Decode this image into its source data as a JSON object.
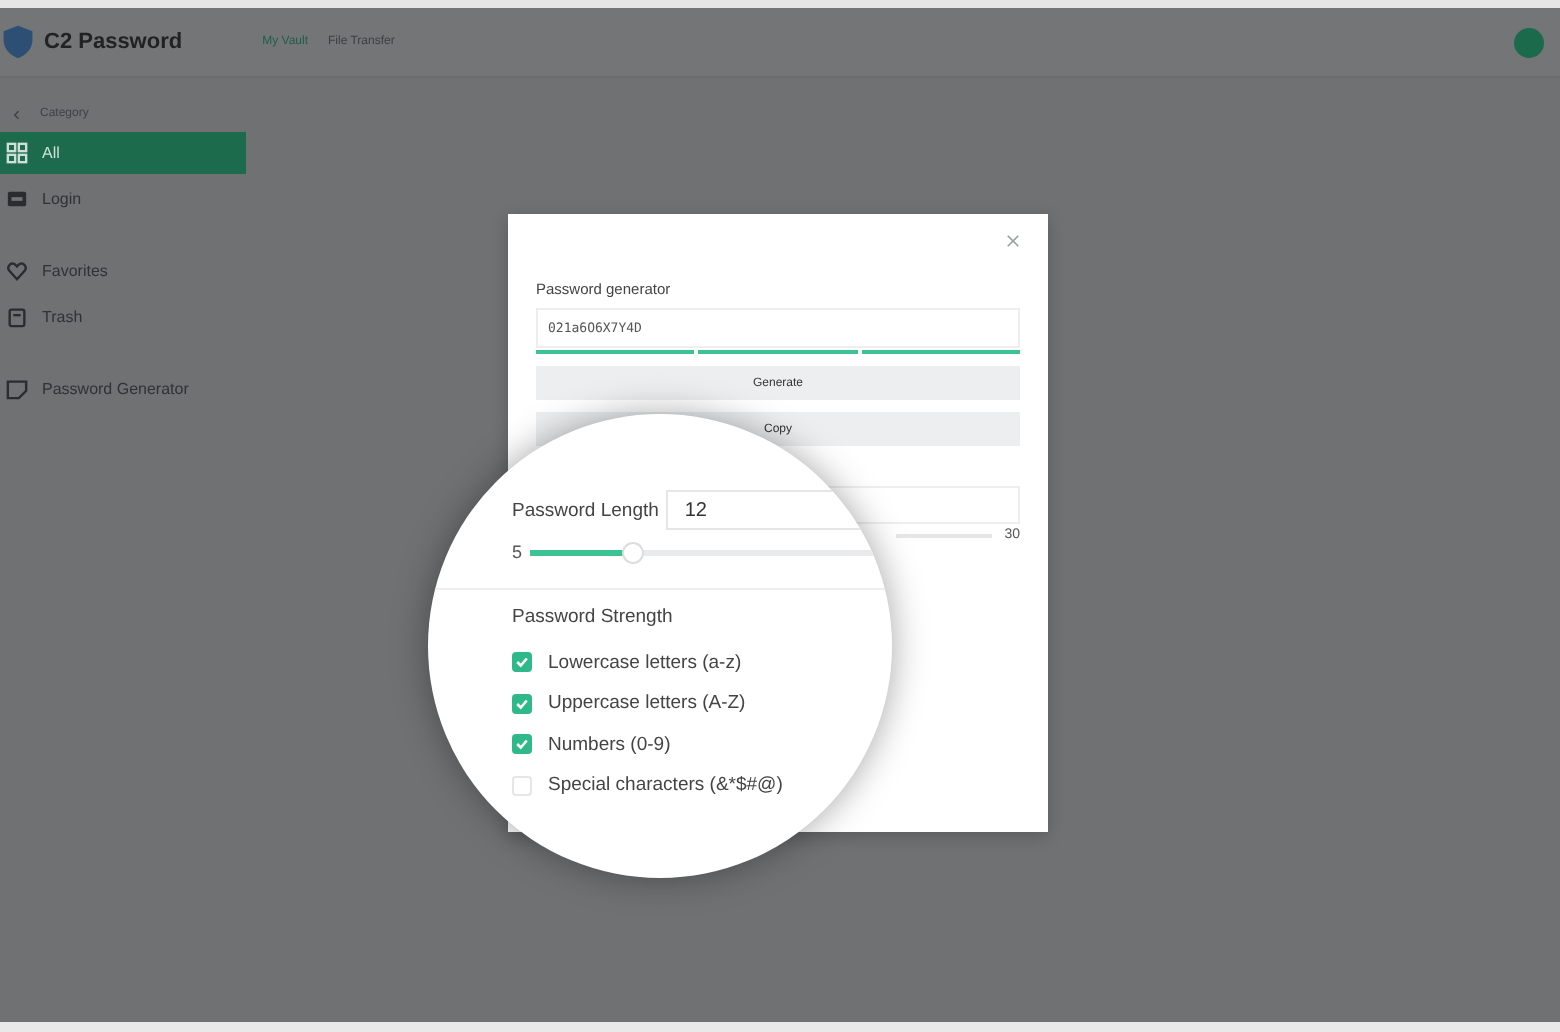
{
  "app": {
    "name": "C2 Password",
    "nav": [
      {
        "label": "My Vault",
        "selected": true
      },
      {
        "label": "File Transfer",
        "selected": false
      }
    ]
  },
  "sidebar": {
    "heading": "Category",
    "sections": [
      [
        {
          "label": "All",
          "kind": "grid",
          "selected": true
        },
        {
          "label": "Login",
          "kind": "card",
          "selected": false
        }
      ],
      [
        {
          "label": "Favorites",
          "kind": "heart",
          "selected": false
        },
        {
          "label": "Trash",
          "kind": "bin",
          "selected": false
        }
      ],
      [
        {
          "label": "Password Generator",
          "kind": "tag",
          "selected": false
        }
      ]
    ]
  },
  "dialog": {
    "title": "Password generator",
    "password": "021a6O6X7Y4D",
    "buttons": [
      "Generate",
      "Copy"
    ],
    "length_label": "Password Length",
    "length": "12",
    "slider": {
      "min_label": "5",
      "max_label": "30",
      "level": 0.28
    },
    "strength_label": "Password Strength",
    "options": [
      {
        "label": "Lowercase letters (a-z)",
        "checked": true
      },
      {
        "label": "Uppercase letters (A-Z)",
        "checked": true
      },
      {
        "label": "Numbers (0-9)",
        "checked": true
      },
      {
        "label": "Special characters (&*$#@)",
        "checked": false
      }
    ]
  }
}
